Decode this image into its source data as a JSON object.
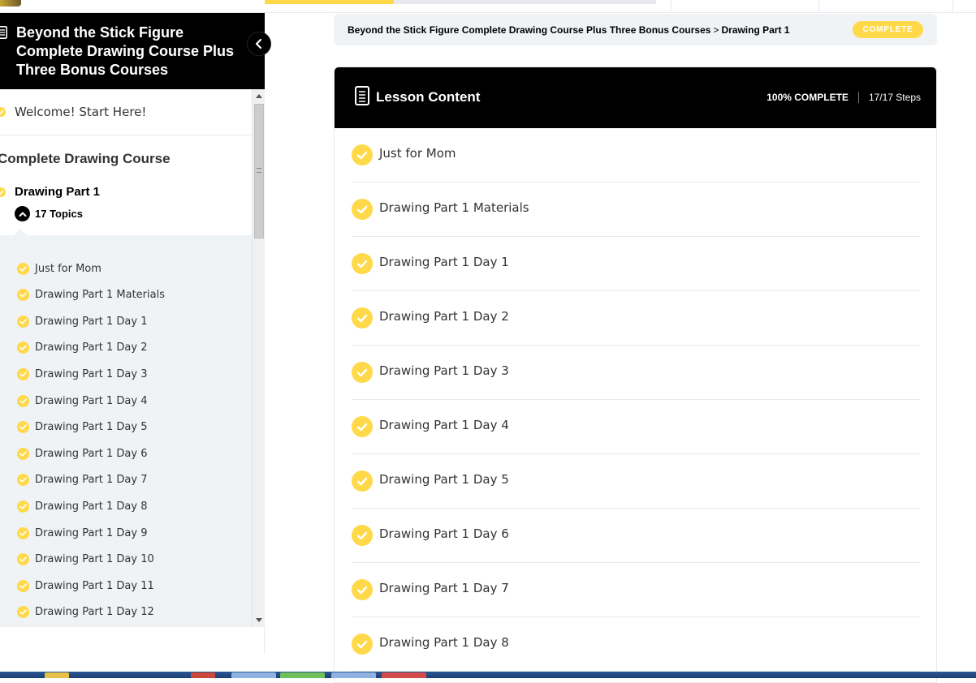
{
  "sidebar": {
    "course_title": "Beyond the Stick Figure Complete Drawing Course Plus Three Bonus Courses",
    "welcome_label": "Welcome! Start Here!",
    "section_title": "Complete Drawing Course",
    "lesson_title": "Drawing Part 1",
    "topics_count_label": "17 Topics",
    "topics": [
      "Just for Mom",
      "Drawing Part 1 Materials",
      "Drawing Part 1 Day 1",
      "Drawing Part 1 Day 2",
      "Drawing Part 1 Day 3",
      "Drawing Part 1 Day 4",
      "Drawing Part 1 Day 5",
      "Drawing Part 1 Day 6",
      "Drawing Part 1 Day 7",
      "Drawing Part 1 Day 8",
      "Drawing Part 1 Day 9",
      "Drawing Part 1 Day 10",
      "Drawing Part 1 Day 11",
      "Drawing Part 1 Day 12"
    ]
  },
  "breadcrumb": {
    "course": "Beyond the Stick Figure Complete Drawing Course Plus Three Bonus Courses",
    "separator": ">",
    "lesson": "Drawing Part 1",
    "status_badge": "COMPLETE"
  },
  "lesson_content": {
    "title": "Lesson Content",
    "percent_complete": "100% COMPLETE",
    "steps": "17/17 Steps",
    "items": [
      "Just for Mom",
      "Drawing Part 1 Materials",
      "Drawing Part 1 Day 1",
      "Drawing Part 1 Day 2",
      "Drawing Part 1 Day 3",
      "Drawing Part 1 Day 4",
      "Drawing Part 1 Day 5",
      "Drawing Part 1 Day 6",
      "Drawing Part 1 Day 7",
      "Drawing Part 1 Day 8"
    ]
  },
  "progress": {
    "fraction": 0.33
  },
  "colors": {
    "accent": "#ffd949",
    "header_bg": "#000000",
    "panel_bg": "#f0f3f6",
    "border": "#e7e9ec"
  },
  "icons": {
    "doc": "document-icon",
    "check": "check-circle-icon",
    "collapse": "chevron-left-icon",
    "expand": "chevron-up-icon"
  }
}
